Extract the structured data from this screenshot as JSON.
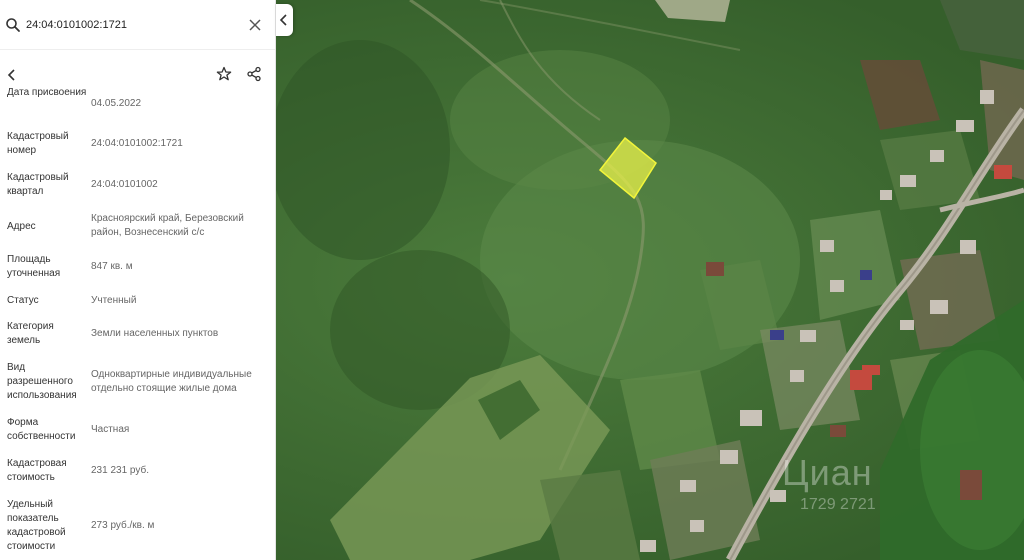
{
  "search": {
    "value": "24:04:0101002:1721",
    "icon": "search-icon",
    "clear_icon": "close-icon"
  },
  "toolbar": {
    "back_icon": "chevron-left-icon",
    "favorite_icon": "star-icon",
    "share_icon": "share-icon"
  },
  "details": [
    {
      "label": "Дата присвоения",
      "value": "04.05.2022"
    },
    {
      "label": "Кадастровый номер",
      "value": "24:04:0101002:1721"
    },
    {
      "label": "Кадастровый квартал",
      "value": "24:04:0101002"
    },
    {
      "label": "Адрес",
      "value": "Красноярский край, Березовский район, Вознесенский с/с"
    },
    {
      "label": "Площадь уточненная",
      "value": "847 кв. м"
    },
    {
      "label": "Статус",
      "value": "Учтенный"
    },
    {
      "label": "Категория земель",
      "value": "Земли населенных пунктов"
    },
    {
      "label": "Вид разрешенного использования",
      "value": "Одноквартирные индивидуальные отдельно стоящие жилые дома"
    },
    {
      "label": "Форма собственности",
      "value": "Частная"
    },
    {
      "label": "Кадастровая стоимость",
      "value": "231 231 руб."
    },
    {
      "label": "Удельный показатель кадастровой стоимости",
      "value": "273 руб./кв. м"
    }
  ],
  "map": {
    "parcel_color": "#e8f04a",
    "watermark": "Циан",
    "watermark_sub": "1729 2721"
  },
  "collapse_icon": "chevron-left-icon"
}
